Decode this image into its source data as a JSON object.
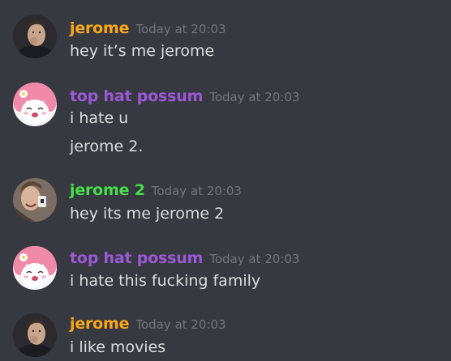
{
  "messages": [
    {
      "username": "jerome",
      "name_color": "#faa61a",
      "avatar_icon": "man-face-avatar",
      "timestamp": "Today at 20:03",
      "lines": [
        "hey it’s me jerome"
      ]
    },
    {
      "username": "top hat possum",
      "name_color": "#9b59d6",
      "avatar_icon": "pink-bunny-avatar",
      "timestamp": "Today at 20:03",
      "lines": [
        "i hate u",
        "jerome 2."
      ]
    },
    {
      "username": "jerome 2",
      "name_color": "#43e04a",
      "avatar_icon": "man-phone-avatar",
      "timestamp": "Today at 20:03",
      "lines": [
        "hey its me jerome 2"
      ]
    },
    {
      "username": "top hat possum",
      "name_color": "#9b59d6",
      "avatar_icon": "pink-bunny-avatar",
      "timestamp": "Today at 20:03",
      "lines": [
        "i hate this fucking family"
      ]
    },
    {
      "username": "jerome",
      "name_color": "#faa61a",
      "avatar_icon": "man-face-avatar",
      "timestamp": "Today at 20:03",
      "lines": [
        "i like movies"
      ]
    }
  ]
}
